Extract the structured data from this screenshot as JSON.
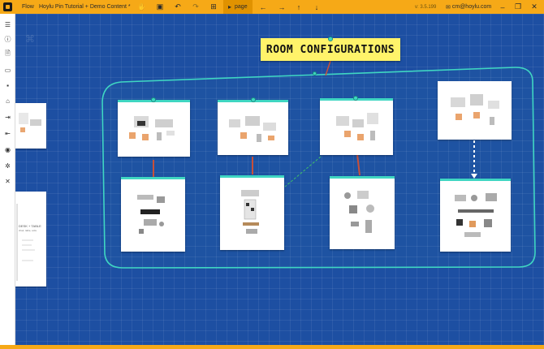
{
  "titlebar": {
    "menu_label": "Flow",
    "document_title": "Hoylu Pin Tutorial + Demo Content *",
    "page_label": "page",
    "version": "v: 3.5.199",
    "user_email": "cm@hoylu.com"
  },
  "board": {
    "title_note": "ROOM CONFIGURATIONS"
  },
  "sidecards": {
    "doc_card_text": "DESK + TABLE",
    "doc_card_subtext": "chair, table, sofa"
  },
  "colors": {
    "accent": "#f6a917",
    "canvas": "#1d4fa2",
    "teal": "#3fd6c2",
    "note": "#fff36a",
    "connector": "#c8503a"
  },
  "icons": {
    "left_toolbar": [
      "menu-icon",
      "info-icon",
      "document-icon",
      "folder-open-icon",
      "save-icon",
      "home-icon",
      "import-icon",
      "export-icon",
      "camera-icon",
      "settings-icon",
      "close-icon"
    ],
    "top_toolbar": [
      "hand-icon",
      "save-icon",
      "undo-icon",
      "redo-icon",
      "globe-icon",
      "page-icon",
      "arrow-left-icon",
      "arrow-right-icon",
      "arrow-up-icon",
      "arrow-down-icon"
    ]
  }
}
